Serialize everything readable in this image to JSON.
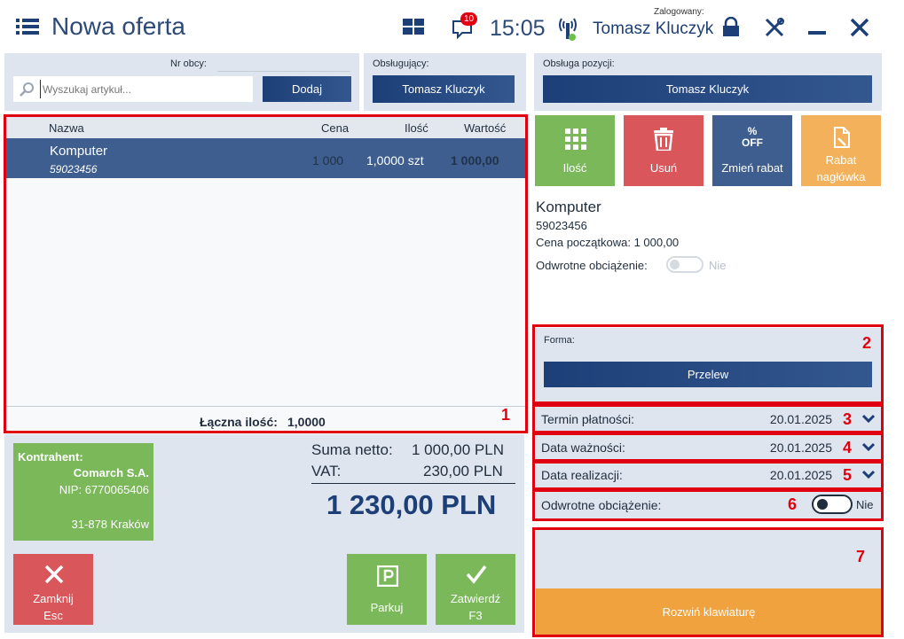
{
  "header": {
    "title": "Nowa oferta",
    "notification_count": "10",
    "time": "15:05",
    "logged_label": "Zalogowany:",
    "user": "Tomasz Kluczyk"
  },
  "search": {
    "nr_obcy_label": "Nr obcy:",
    "placeholder": "Wyszukaj artykuł...",
    "add_label": "Dodaj"
  },
  "obslugujacy": {
    "label": "Obsługujący:",
    "value": "Tomasz Kluczyk"
  },
  "obsluga_pozycji": {
    "label": "Obsługa pozycji:",
    "value": "Tomasz Kluczyk"
  },
  "table": {
    "headers": {
      "name": "Nazwa",
      "price": "Cena",
      "qty": "Ilość",
      "value": "Wartość"
    },
    "rows": [
      {
        "name": "Komputer",
        "code": "59023456",
        "price": "1 000",
        "qty": "1,0000 szt",
        "value": "1 000,00"
      }
    ],
    "total_label": "Łączna ilość:",
    "total_value": "1,0000"
  },
  "actions": {
    "qty": "Ilość",
    "delete": "Usuń",
    "discount_icon": "% OFF",
    "discount": "Zmień rabat",
    "header_discount_line1": "Rabat",
    "header_discount_line2": "nagłówka"
  },
  "details": {
    "name": "Komputer",
    "code": "59023456",
    "price_label": "Cena początkowa: 1 000,00",
    "reverse_label": "Odwrotne obciążenie:",
    "reverse_value": "Nie"
  },
  "payment": {
    "form_label": "Forma:",
    "form_value": "Przelew",
    "term_label": "Termin płatności:",
    "term_value": "20.01.2025",
    "validity_label": "Data ważności:",
    "validity_value": "20.01.2025",
    "realization_label": "Data realizacji:",
    "realization_value": "20.01.2025",
    "reverse_label": "Odwrotne obciążenie:",
    "reverse_value": "Nie"
  },
  "contractor": {
    "label": "Kontrahent:",
    "name": "Comarch S.A.",
    "nip": "NIP: 6770065406",
    "city": "31-878  Kraków"
  },
  "summary": {
    "net_label": "Suma netto:",
    "net_value": "1 000,00 PLN",
    "vat_label": "VAT:",
    "vat_value": "230,00 PLN",
    "total": "1 230,00 PLN"
  },
  "bottom": {
    "close_line1": "Zamknij",
    "close_line2": "Esc",
    "park": "Parkuj",
    "confirm_line1": "Zatwierdź",
    "confirm_line2": "F3",
    "keyboard": "Rozwiń klawiaturę"
  },
  "annotations": [
    "1",
    "2",
    "3",
    "4",
    "5",
    "6",
    "7"
  ],
  "colors": {
    "accent_blue": "#1d3f78",
    "green": "#7ab85a",
    "red": "#d9565a",
    "orange": "#f2b15a",
    "annotation_red": "#e00010"
  }
}
